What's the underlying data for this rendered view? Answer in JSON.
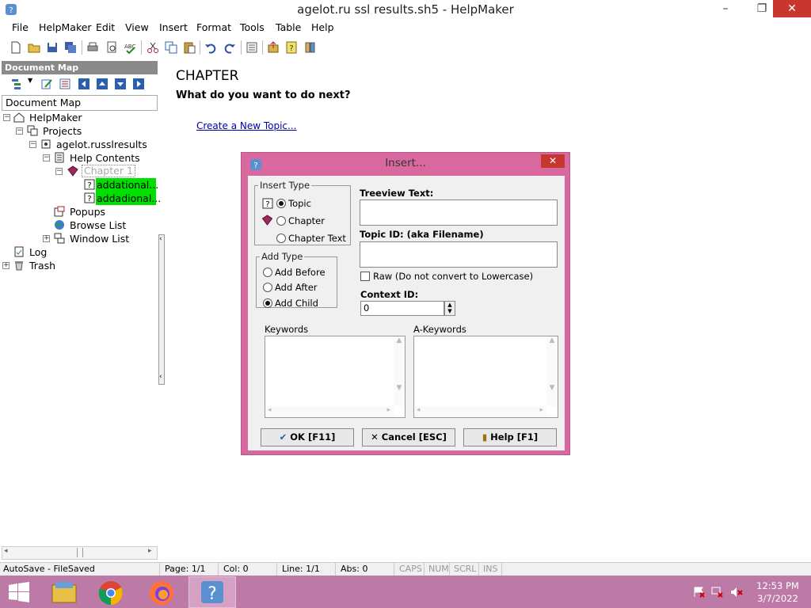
{
  "window": {
    "title": "agelot.ru ssl results.sh5 - HelpMaker",
    "minimize": "–",
    "restore": "❐",
    "close": "✕"
  },
  "menu": [
    "File",
    "HelpMaker",
    "Edit",
    "View",
    "Insert",
    "Format",
    "Tools",
    "Table",
    "Help"
  ],
  "toolbar_icons": [
    "new-icon",
    "open-icon",
    "save-icon",
    "save-all-icon",
    "print-icon",
    "print-preview-icon",
    "spellcheck-icon",
    "cut-icon",
    "copy-icon",
    "paste-icon",
    "undo-icon",
    "redo-icon",
    "properties-icon",
    "export-icon",
    "help-icon",
    "book-icon"
  ],
  "document_map": {
    "header": "Document Map",
    "label": "Document Map",
    "tree": {
      "root": "HelpMaker",
      "projects": "Projects",
      "project": "agelot.russlresults",
      "help_contents": "Help Contents",
      "chapter": "Chapter 1",
      "topic1": "addational...",
      "topic2": "addadional...",
      "popups": "Popups",
      "browse_list": "Browse List",
      "window_list": "Window List",
      "log": "Log",
      "trash": "Trash"
    },
    "highlight_color": "#00e000"
  },
  "content": {
    "title": "CHAPTER",
    "question": "What do you want to do next?",
    "link": "Create a New Topic..."
  },
  "dialog": {
    "title": "Insert...",
    "close": "✕",
    "insert_type": {
      "legend": "Insert Type",
      "topic": "Topic",
      "chapter": "Chapter",
      "chapter_text": "Chapter Text",
      "selected": "Topic"
    },
    "add_type": {
      "legend": "Add Type",
      "before": "Add Before",
      "after": "Add After",
      "child": "Add Child",
      "selected": "Add Child"
    },
    "treeview_text_label": "Treeview Text:",
    "treeview_text_value": "",
    "topic_id_label": "Topic ID: (aka Filename)",
    "topic_id_value": "",
    "raw_label": "Raw (Do not convert to Lowercase)",
    "raw_checked": false,
    "context_id_label": "Context ID:",
    "context_id_value": "0",
    "keywords_label": "Keywords",
    "akeywords_label": "A-Keywords",
    "ok": "OK [F11]",
    "cancel": "Cancel [ESC]",
    "help": "Help [F1]",
    "frame_color": "#d9689f"
  },
  "status": {
    "autosave": "AutoSave - FileSaved",
    "page": "Page: 1/1",
    "col": "Col: 0",
    "line": "Line: 1/1",
    "abs": "Abs: 0",
    "caps": "CAPS",
    "num": "NUM",
    "scrl": "SCRL",
    "ins": "INS"
  },
  "taskbar": {
    "apps": [
      "start-icon",
      "file-explorer-icon",
      "chrome-icon",
      "firefox-icon",
      "helpmaker-icon"
    ],
    "time": "12:53 PM",
    "date": "3/7/2022",
    "color": "#be7aa7"
  }
}
